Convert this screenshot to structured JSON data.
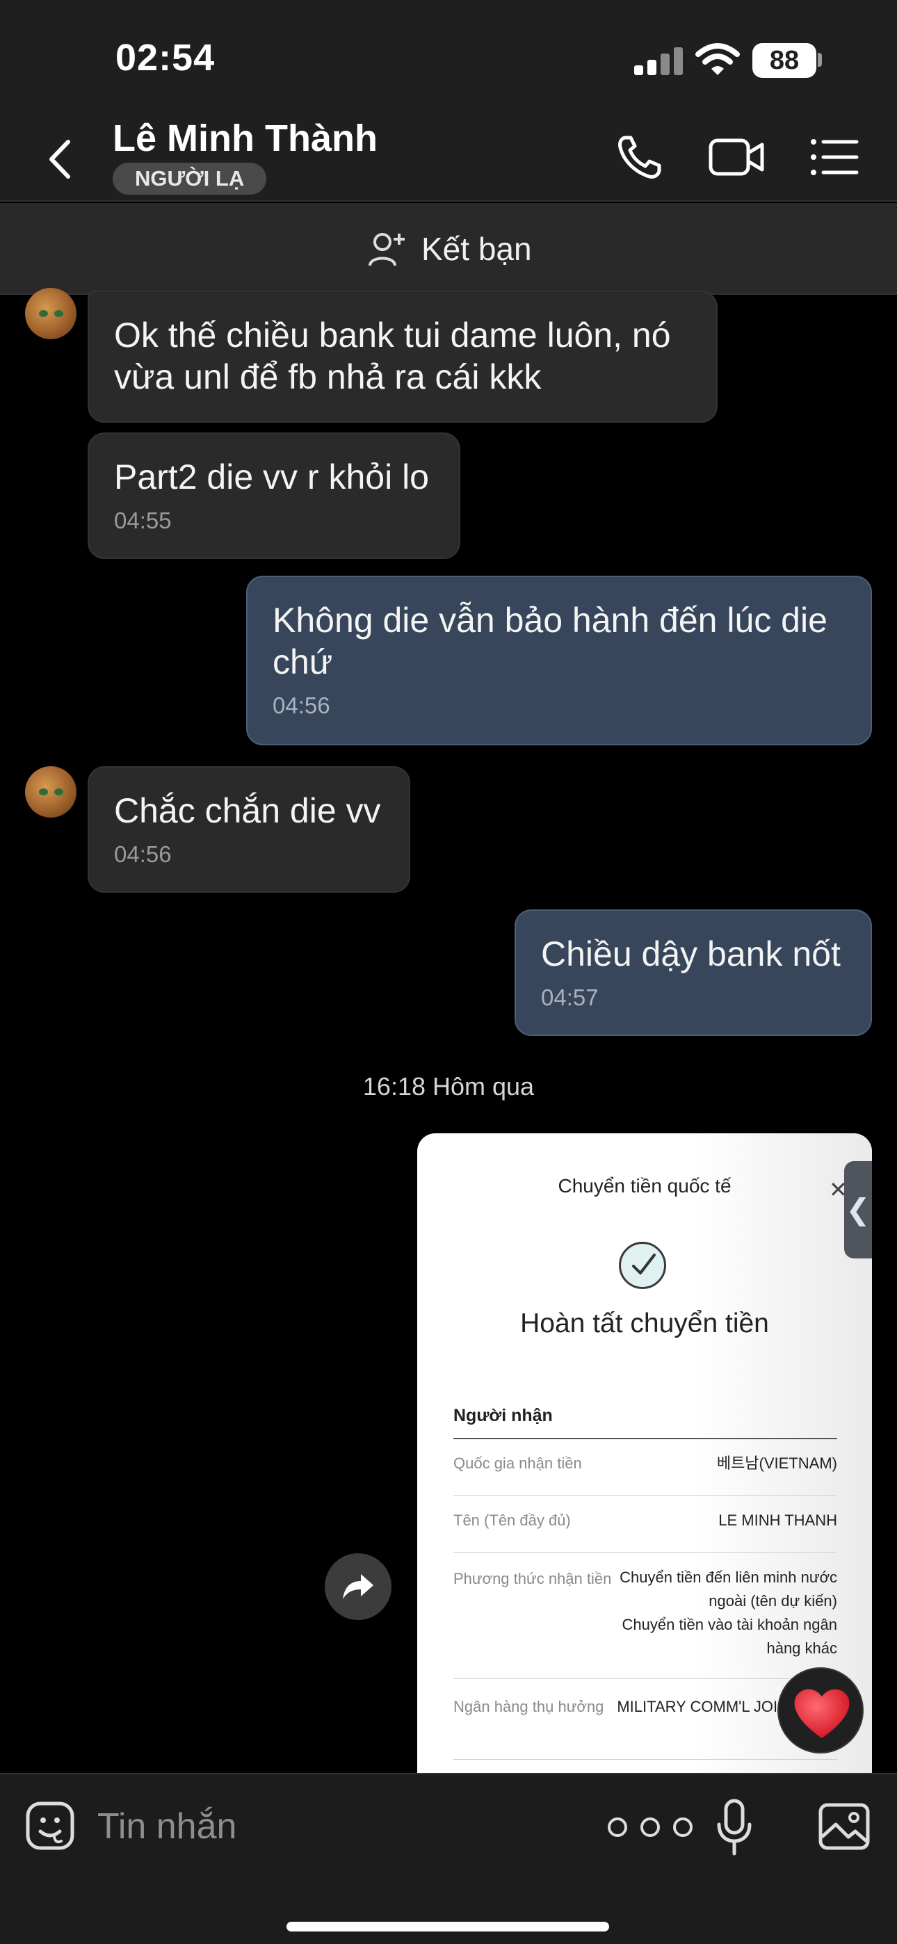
{
  "status_bar": {
    "time": "02:54",
    "battery": "88"
  },
  "header": {
    "contact_name": "Lê Minh Thành",
    "badge": "NGƯỜI LẠ"
  },
  "friend_bar": {
    "label": "Kết bạn"
  },
  "messages": [
    {
      "direction": "in",
      "text": "Ok thế chiều bank tui dame luôn, nó vừa unl để fb nhả ra cái kkk",
      "time": ""
    },
    {
      "direction": "in",
      "text": "Part2 die vv r khỏi lo",
      "time": "04:55"
    },
    {
      "direction": "out",
      "text": "Không die vẫn bảo hành đến lúc die chứ",
      "time": "04:56"
    },
    {
      "direction": "in",
      "text": "Chắc chắn die vv",
      "time": "04:56"
    },
    {
      "direction": "out",
      "text": "Chiều dậy bank nốt",
      "time": "04:57"
    }
  ],
  "day_separator": "16:18 Hôm qua",
  "image_message": {
    "title": "Chuyển tiền quốc tế",
    "status": "Hoàn tất chuyển tiền",
    "section": "Người nhận",
    "rows": [
      {
        "label": "Quốc gia nhận tiền",
        "value": "베트남(VIETNAM)"
      },
      {
        "label": "Tên (Tên đầy đủ)",
        "value": "LE MINH THANH"
      },
      {
        "label": "Phương thức nhận tiền",
        "value_lines": [
          "Chuyển tiền đến liên minh nước",
          "ngoài (tên dự kiến)",
          "Chuyển tiền vào tài khoản ngân",
          "hàng khác"
        ]
      },
      {
        "label": "Ngân hàng thụ hưởng",
        "value": "MILITARY COMM'L JOIN"
      }
    ]
  },
  "composer": {
    "placeholder": "Tin nhắn"
  },
  "colors": {
    "incoming_bubble": "#2a2a2a",
    "outgoing_bubble": "#37465a",
    "background": "#000000",
    "heart": "#e0202e"
  },
  "icons": [
    "back-icon",
    "phone-icon",
    "video-call-icon",
    "menu-list-icon",
    "add-friend-icon",
    "share-icon",
    "heart-icon",
    "sticker-icon",
    "more-icon",
    "mic-icon",
    "gallery-icon"
  ]
}
